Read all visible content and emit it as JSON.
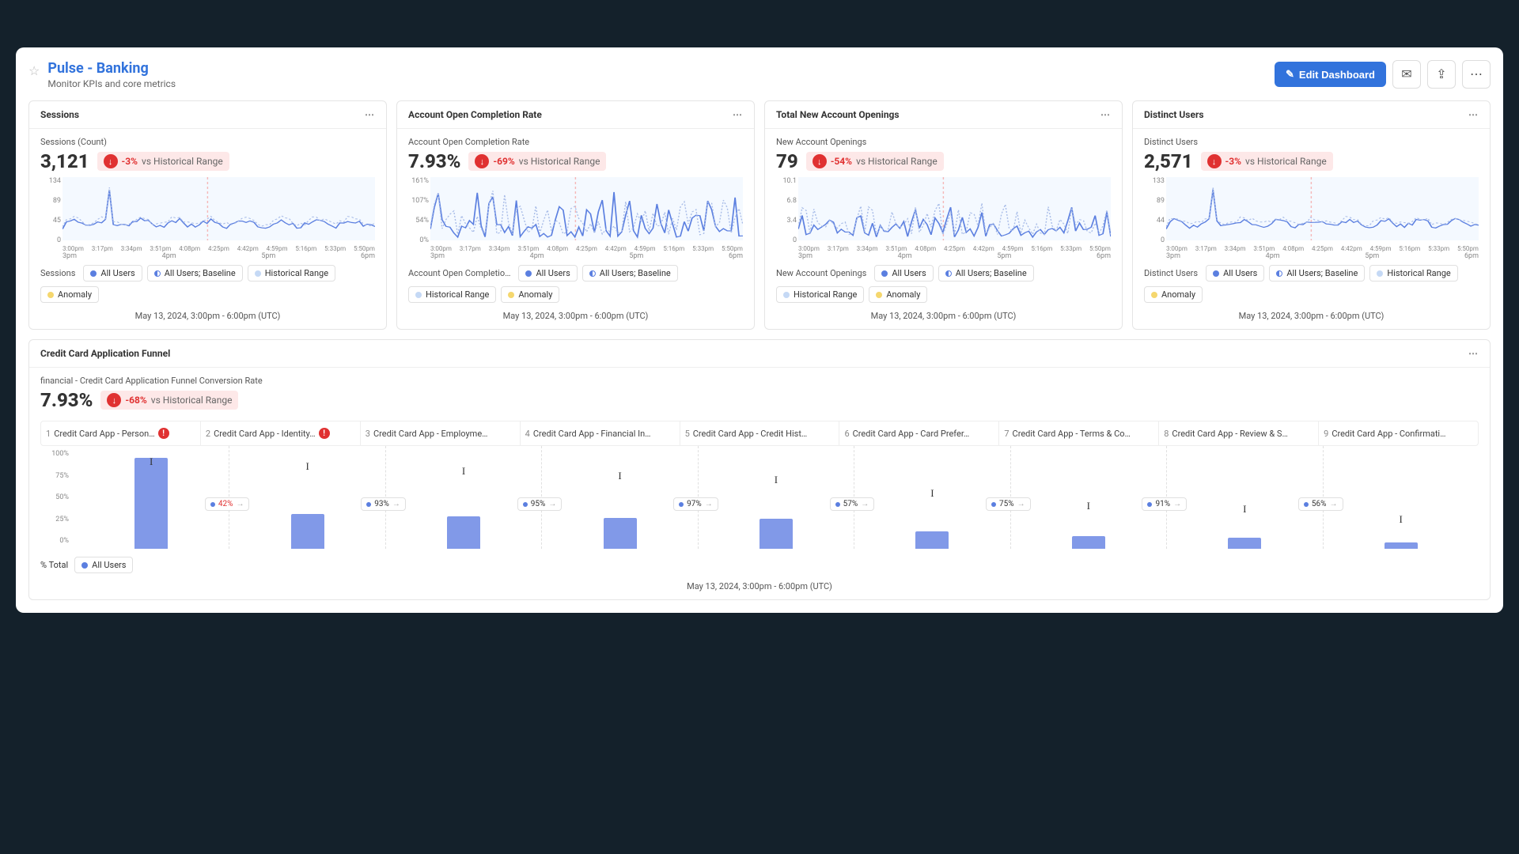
{
  "header": {
    "title": "Pulse - Banking",
    "subtitle": "Monitor KPIs and core metrics",
    "edit_label": "Edit Dashboard"
  },
  "common": {
    "hist_range_label": "vs Historical Range",
    "timestamp": "May 13, 2024, 3:00pm - 6:00pm (UTC)",
    "legend_all_users": "All Users",
    "legend_baseline": "All Users; Baseline",
    "legend_hist": "Historical Range",
    "legend_anomaly": "Anomaly",
    "x_minor": [
      "3:00pm",
      "3:17pm",
      "3:34pm",
      "3:51pm",
      "4:08pm",
      "4:25pm",
      "4:42pm",
      "4:59pm",
      "5:16pm",
      "5:33pm",
      "5:50pm"
    ],
    "x_major": [
      "3pm",
      "4pm",
      "5pm",
      "6pm"
    ]
  },
  "cards": [
    {
      "title": "Sessions",
      "metric_label": "Sessions (Count)",
      "value": "3,121",
      "delta": "-3%",
      "y_ticks": [
        "134",
        "89",
        "45",
        "0"
      ],
      "legend_label": "Sessions"
    },
    {
      "title": "Account Open Completion Rate",
      "metric_label": "Account Open Completion Rate",
      "value": "7.93%",
      "delta": "-69%",
      "y_ticks": [
        "161%",
        "107%",
        "54%",
        "0%"
      ],
      "legend_label": "Account Open Completio…"
    },
    {
      "title": "Total New Account Openings",
      "metric_label": "New Account Openings",
      "value": "79",
      "delta": "-54%",
      "y_ticks": [
        "10.1",
        "6.8",
        "3.4",
        "0"
      ],
      "legend_label": "New Account Openings"
    },
    {
      "title": "Distinct Users",
      "metric_label": "Distinct Users",
      "value": "2,571",
      "delta": "-3%",
      "y_ticks": [
        "133",
        "89",
        "44",
        "0"
      ],
      "legend_label": "Distinct Users"
    }
  ],
  "chart_data": [
    {
      "type": "line",
      "title": "Sessions (Count)",
      "ylim": [
        0,
        134
      ],
      "ylabel": "",
      "xlabel": "",
      "series": [
        {
          "name": "All Users",
          "approx_mean": 25,
          "approx_spike": 90
        }
      ]
    },
    {
      "type": "line",
      "title": "Account Open Completion Rate",
      "ylim": [
        0,
        161
      ],
      "ylabel": "%",
      "xlabel": "",
      "series": [
        {
          "name": "All Users",
          "approx_range": [
            0,
            120
          ]
        }
      ]
    },
    {
      "type": "line",
      "title": "New Account Openings",
      "ylim": [
        0,
        10.1
      ],
      "ylabel": "",
      "xlabel": "",
      "series": [
        {
          "name": "All Users",
          "approx_range": [
            0,
            7
          ]
        }
      ]
    },
    {
      "type": "line",
      "title": "Distinct Users",
      "ylim": [
        0,
        133
      ],
      "ylabel": "",
      "xlabel": "",
      "series": [
        {
          "name": "All Users",
          "approx_mean": 22,
          "approx_spike": 85
        }
      ]
    }
  ],
  "funnel": {
    "title": "Credit Card Application Funnel",
    "metric_label": "financial - Credit Card Application Funnel Conversion Rate",
    "value": "7.93%",
    "delta": "-68%",
    "y_label": "% Total",
    "y_ticks": [
      "100%",
      "75%",
      "50%",
      "25%",
      "0%"
    ],
    "legend_all_users": "All Users",
    "timestamp": "May 13, 2024, 3:00pm - 6:00pm (UTC)",
    "steps": [
      {
        "n": "1",
        "name": "Credit Card App - Person…",
        "warn": true,
        "bar": 100,
        "err_top": 12,
        "conv": "42%",
        "conv_red": true
      },
      {
        "n": "2",
        "name": "Credit Card App - Identity…",
        "warn": true,
        "bar": 38,
        "err_top": 18,
        "conv": "93%"
      },
      {
        "n": "3",
        "name": "Credit Card App - Employme…",
        "bar": 36,
        "err_top": 24,
        "conv": "95%"
      },
      {
        "n": "4",
        "name": "Credit Card App - Financial In…",
        "bar": 34,
        "err_top": 30,
        "conv": "97%"
      },
      {
        "n": "5",
        "name": "Credit Card App - Credit Hist…",
        "bar": 33,
        "err_top": 35,
        "conv": "57%"
      },
      {
        "n": "6",
        "name": "Credit Card App - Card Prefer…",
        "bar": 19,
        "err_top": 52,
        "conv": "75%"
      },
      {
        "n": "7",
        "name": "Credit Card App - Terms & Co…",
        "bar": 14,
        "err_top": 68,
        "conv": "91%"
      },
      {
        "n": "8",
        "name": "Credit Card App - Review & S…",
        "bar": 12,
        "err_top": 72,
        "conv": "56%"
      },
      {
        "n": "9",
        "name": "Credit Card App - Confirmati…",
        "bar": 7,
        "err_top": 85
      }
    ],
    "chart_data": {
      "type": "bar",
      "ylabel": "% Total",
      "ylim": [
        0,
        100
      ],
      "categories": [
        "Personal",
        "Identity",
        "Employment",
        "Financial Info",
        "Credit History",
        "Card Preferences",
        "Terms & Conditions",
        "Review & Submit",
        "Confirmation"
      ],
      "values": [
        100,
        38,
        36,
        34,
        33,
        19,
        14,
        12,
        7
      ],
      "step_conversion": [
        42,
        93,
        95,
        97,
        57,
        75,
        91,
        56
      ]
    }
  }
}
